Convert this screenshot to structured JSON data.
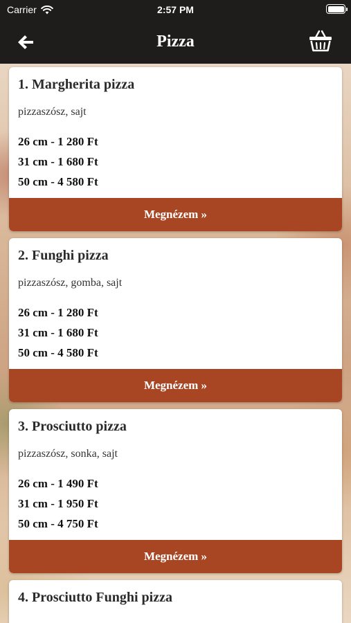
{
  "status_bar": {
    "carrier": "Carrier",
    "time": "2:57 PM"
  },
  "nav": {
    "title": "Pizza",
    "back_icon": "arrow-left-icon",
    "cart_icon": "basket-icon"
  },
  "colors": {
    "nav_background": "#1f1d1c",
    "button_background": "#a84624",
    "card_background": "#ffffff"
  },
  "items": [
    {
      "title": "1. Margherita pizza",
      "ingredients": "pizzaszósz, sajt",
      "prices": [
        "26 cm - 1 280 Ft",
        "31 cm - 1 680 Ft",
        "50 cm - 4 580 Ft"
      ],
      "button": "Megnézem »"
    },
    {
      "title": "2. Funghi pizza",
      "ingredients": "pizzaszósz, gomba, sajt",
      "prices": [
        "26 cm - 1 280 Ft",
        "31 cm - 1 680 Ft",
        "50 cm - 4 580 Ft"
      ],
      "button": "Megnézem »"
    },
    {
      "title": "3. Prosciutto pizza",
      "ingredients": "pizzaszósz, sonka, sajt",
      "prices": [
        "26 cm - 1 490 Ft",
        "31 cm - 1 950 Ft",
        "50 cm - 4 750 Ft"
      ],
      "button": "Megnézem »"
    },
    {
      "title": "4. Prosciutto Funghi pizza"
    }
  ]
}
